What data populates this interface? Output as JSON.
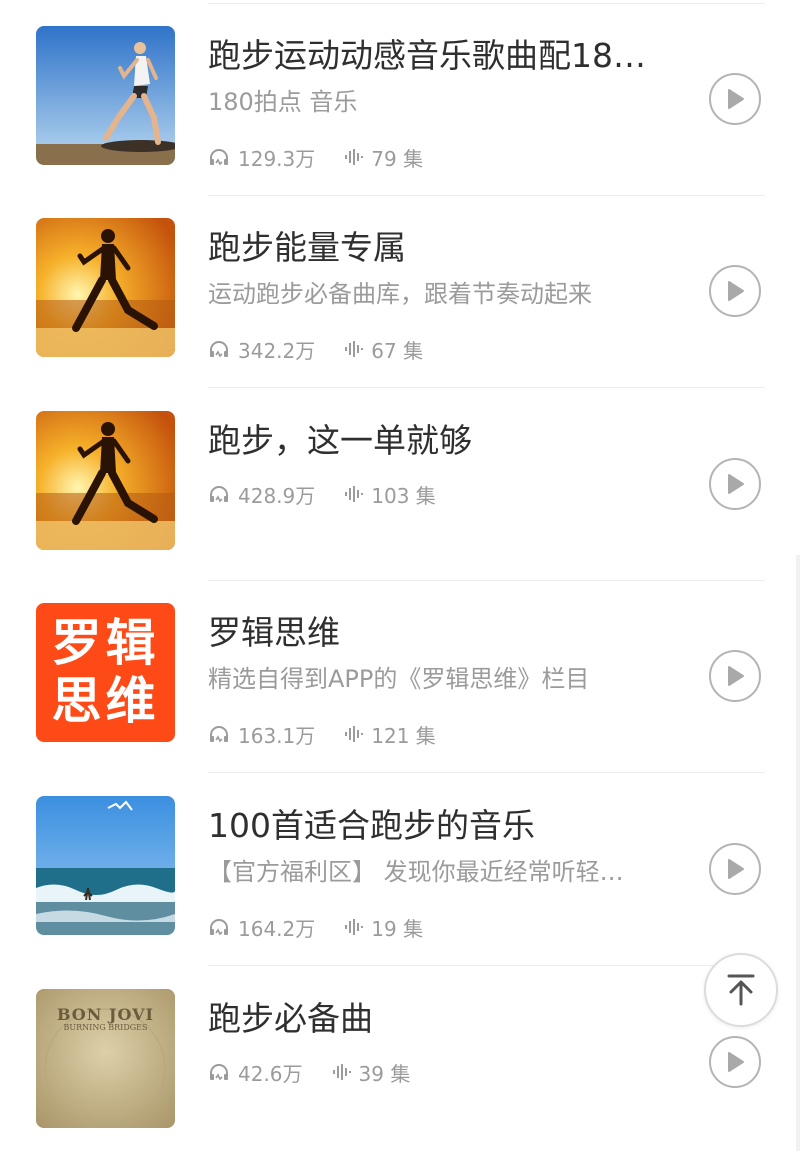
{
  "colors": {
    "title": "#2f2f2f",
    "meta": "#9b9b9b",
    "play_border": "#b4b4b4",
    "logic_orange": "#fe4a16"
  },
  "icons": {
    "plays": "headphones-icon",
    "episodes": "audio-wave-icon",
    "play": "play-icon",
    "back_to_top": "arrow-up-to-top-icon"
  },
  "items": [
    {
      "title": "跑步运动动感音乐歌曲配18…",
      "subtitle": "180拍点 音乐",
      "plays": "129.3万",
      "episodes": "79 集"
    },
    {
      "title": "跑步能量专属",
      "subtitle": "运动跑步必备曲库，跟着节奏动起来",
      "plays": "342.2万",
      "episodes": "67 集"
    },
    {
      "title": "跑步，这一单就够",
      "subtitle": "",
      "plays": "428.9万",
      "episodes": "103 集"
    },
    {
      "title": "罗辑思维",
      "subtitle": "精选自得到APP的《罗辑思维》栏目",
      "plays": "163.1万",
      "episodes": "121 集",
      "cover": {
        "line1": "罗辑",
        "line2": "思维"
      }
    },
    {
      "title": "100首适合跑步的音乐",
      "subtitle": "【官方福利区】 发现你最近经常听轻…",
      "plays": "164.2万",
      "episodes": "19 集"
    },
    {
      "title": "跑步必备曲",
      "subtitle": "",
      "plays": "42.6万",
      "episodes": "39 集",
      "cover": {
        "line1": "BON JOVI",
        "line2": "BURNING BRIDGES"
      }
    }
  ]
}
